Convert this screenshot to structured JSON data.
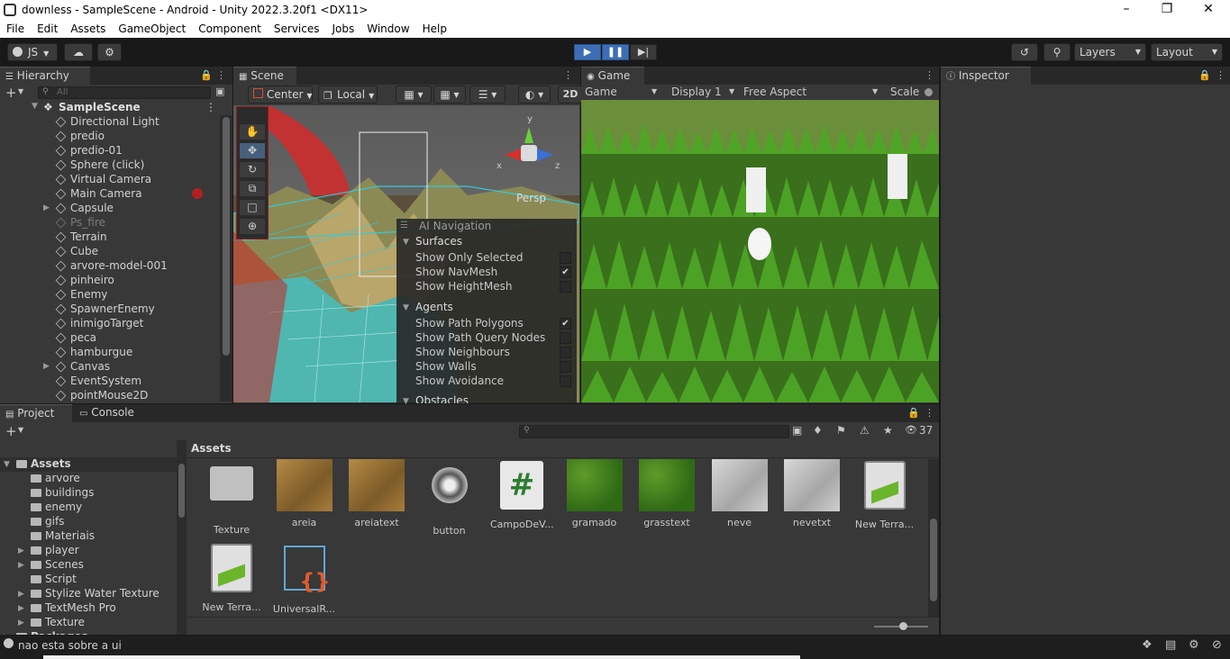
{
  "window": {
    "title": "downless - SampleScene - Android - Unity 2022.3.20f1 <DX11>"
  },
  "menu": [
    "File",
    "Edit",
    "Assets",
    "GameObject",
    "Component",
    "Services",
    "Jobs",
    "Window",
    "Help"
  ],
  "toolbar": {
    "account": "JS",
    "layers": "Layers",
    "layout": "Layout"
  },
  "hierarchy": {
    "tab": "Hierarchy",
    "search_placeholder": "All",
    "scene": "SampleScene",
    "items": [
      {
        "label": "Directional Light",
        "expandable": false,
        "dim": false
      },
      {
        "label": "predio",
        "expandable": false,
        "dim": false
      },
      {
        "label": "predio-01",
        "expandable": false,
        "dim": false
      },
      {
        "label": "Sphere (click)",
        "expandable": false,
        "dim": false
      },
      {
        "label": "Virtual Camera",
        "expandable": false,
        "dim": false
      },
      {
        "label": "Main Camera",
        "expandable": false,
        "dim": false
      },
      {
        "label": "Capsule",
        "expandable": true,
        "dim": false
      },
      {
        "label": "Ps_fire",
        "expandable": false,
        "dim": true
      },
      {
        "label": "Terrain",
        "expandable": false,
        "dim": false
      },
      {
        "label": "Cube",
        "expandable": false,
        "dim": false
      },
      {
        "label": "arvore-model-001",
        "expandable": false,
        "dim": false
      },
      {
        "label": "pinheiro",
        "expandable": false,
        "dim": false
      },
      {
        "label": "Enemy",
        "expandable": false,
        "dim": false
      },
      {
        "label": "SpawnerEnemy",
        "expandable": false,
        "dim": false
      },
      {
        "label": "inimigoTarget",
        "expandable": false,
        "dim": false
      },
      {
        "label": "peca",
        "expandable": false,
        "dim": false
      },
      {
        "label": "hamburgue",
        "expandable": false,
        "dim": false
      },
      {
        "label": "Canvas",
        "expandable": true,
        "dim": false
      },
      {
        "label": "EventSystem",
        "expandable": false,
        "dim": false
      },
      {
        "label": "pointMouse2D",
        "expandable": false,
        "dim": false
      }
    ]
  },
  "scene": {
    "tab": "Scene",
    "pivot": "Center",
    "space": "Local",
    "mode2d": "2D",
    "persp": "Persp",
    "gizmo_axes": {
      "y": "y",
      "x": "x",
      "z": "z"
    },
    "ai_nav": {
      "title": "AI Navigation",
      "surfaces_header": "Surfaces",
      "surfaces": [
        {
          "label": "Show Only Selected",
          "checked": false
        },
        {
          "label": "Show NavMesh",
          "checked": true
        },
        {
          "label": "Show HeightMesh",
          "checked": false
        }
      ],
      "agents_header": "Agents",
      "agents": [
        {
          "label": "Show Path Polygons",
          "checked": true
        },
        {
          "label": "Show Path Query Nodes",
          "checked": false
        },
        {
          "label": "Show Neighbours",
          "checked": false
        },
        {
          "label": "Show Walls",
          "checked": false
        },
        {
          "label": "Show Avoidance",
          "checked": false
        }
      ],
      "obstacles_header": "Obstacles"
    }
  },
  "game": {
    "tab": "Game",
    "mode": "Game",
    "display": "Display 1",
    "aspect": "Free Aspect",
    "scale_label": "Scale"
  },
  "inspector": {
    "tab": "Inspector"
  },
  "project": {
    "tab": "Project",
    "console_tab": "Console",
    "hidden_count": "37",
    "breadcrumb": "Assets",
    "tree": [
      {
        "label": "Assets",
        "depth": 0,
        "open": true,
        "expandable": true
      },
      {
        "label": "arvore",
        "depth": 1,
        "expandable": false
      },
      {
        "label": "buildings",
        "depth": 1,
        "expandable": false
      },
      {
        "label": "enemy",
        "depth": 1,
        "expandable": false
      },
      {
        "label": "gifs",
        "depth": 1,
        "expandable": false
      },
      {
        "label": "Materiais",
        "depth": 1,
        "expandable": false
      },
      {
        "label": "player",
        "depth": 1,
        "expandable": true
      },
      {
        "label": "Scenes",
        "depth": 1,
        "expandable": true
      },
      {
        "label": "Script",
        "depth": 1,
        "expandable": false
      },
      {
        "label": "Stylize Water Texture",
        "depth": 1,
        "expandable": true
      },
      {
        "label": "TextMesh Pro",
        "depth": 1,
        "expandable": true
      },
      {
        "label": "Texture",
        "depth": 1,
        "expandable": true
      },
      {
        "label": "Packages",
        "depth": 0,
        "expandable": true
      }
    ],
    "assets": [
      {
        "label": "Texture",
        "kind": "folder"
      },
      {
        "label": "areia",
        "kind": "sand"
      },
      {
        "label": "areiatext",
        "kind": "sand"
      },
      {
        "label": "button",
        "kind": "button"
      },
      {
        "label": "CampoDeV...",
        "kind": "script"
      },
      {
        "label": "gramado",
        "kind": "grass"
      },
      {
        "label": "grasstext",
        "kind": "grass"
      },
      {
        "label": "neve",
        "kind": "snow"
      },
      {
        "label": "nevetxt",
        "kind": "snow"
      },
      {
        "label": "New Terra...",
        "kind": "terrain"
      },
      {
        "label": "New Terra...",
        "kind": "terrain"
      },
      {
        "label": "UniversalR...",
        "kind": "urp"
      }
    ]
  },
  "status": {
    "message": "nao esta sobre a ui"
  },
  "colors": {
    "accent": "#3d6eb3",
    "panel": "#383838",
    "dark": "#282828",
    "grass": "#3d8a1e",
    "sand": "#9a6e2c"
  }
}
